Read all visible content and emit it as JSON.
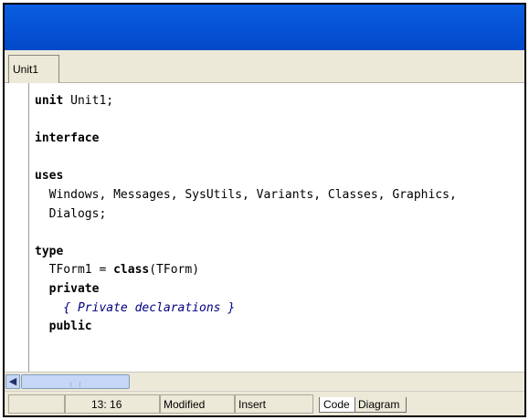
{
  "editor_tab": {
    "label": "Unit1"
  },
  "code_lines": [
    {
      "segments": [
        {
          "t": "unit",
          "k": "kw"
        },
        {
          "t": " Unit1;",
          "k": ""
        }
      ]
    },
    {
      "segments": []
    },
    {
      "segments": [
        {
          "t": "interface",
          "k": "kw"
        }
      ]
    },
    {
      "segments": []
    },
    {
      "segments": [
        {
          "t": "uses",
          "k": "kw"
        }
      ]
    },
    {
      "segments": [
        {
          "t": "  Windows, Messages, SysUtils, Variants, Classes, Graphics,",
          "k": ""
        }
      ]
    },
    {
      "segments": [
        {
          "t": "  Dialogs;",
          "k": ""
        }
      ]
    },
    {
      "segments": []
    },
    {
      "segments": [
        {
          "t": "type",
          "k": "kw"
        }
      ]
    },
    {
      "segments": [
        {
          "t": "  TForm1 = ",
          "k": ""
        },
        {
          "t": "class",
          "k": "kw"
        },
        {
          "t": "(TForm)",
          "k": ""
        }
      ]
    },
    {
      "segments": [
        {
          "t": "  ",
          "k": ""
        },
        {
          "t": "private",
          "k": "kw"
        }
      ]
    },
    {
      "segments": [
        {
          "t": "    { Private declarations }",
          "k": "cm"
        }
      ]
    },
    {
      "segments": [
        {
          "t": "  ",
          "k": ""
        },
        {
          "t": "public",
          "k": "kw"
        }
      ]
    }
  ],
  "status_bar": {
    "position": "13: 16",
    "modified": "Modified",
    "mode": "Insert"
  },
  "bottom_tabs": {
    "code": "Code",
    "diagram": "Diagram"
  },
  "icons": {
    "scroll_left": "arrow-left-icon",
    "scroll_grip": "grip-icon"
  },
  "colors": {
    "title_bar": "#0753d8",
    "comment": "#000080",
    "window_bg": "#ece9d8"
  }
}
